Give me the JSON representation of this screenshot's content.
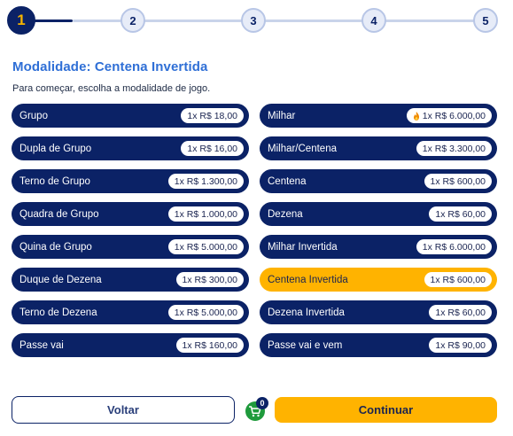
{
  "stepper": {
    "steps": [
      "1",
      "2",
      "3",
      "4",
      "5"
    ],
    "current": 1
  },
  "header": {
    "title": "Modalidade: Centena Invertida",
    "subtitle": "Para começar, escolha a modalidade de jogo."
  },
  "options": {
    "left": [
      {
        "label": "Grupo",
        "price": "1x R$ 18,00"
      },
      {
        "label": "Dupla de Grupo",
        "price": "1x R$ 16,00"
      },
      {
        "label": "Terno de Grupo",
        "price": "1x R$ 1.300,00"
      },
      {
        "label": "Quadra de Grupo",
        "price": "1x R$ 1.000,00"
      },
      {
        "label": "Quina de Grupo",
        "price": "1x R$ 5.000,00"
      },
      {
        "label": "Duque de Dezena",
        "price": "1x R$ 300,00"
      },
      {
        "label": "Terno de Dezena",
        "price": "1x R$ 5.000,00"
      },
      {
        "label": "Passe vai",
        "price": "1x R$ 160,00"
      }
    ],
    "right": [
      {
        "label": "Milhar",
        "price": "1x R$ 6.000,00",
        "icon": "fire-icon"
      },
      {
        "label": "Milhar/Centena",
        "price": "1x R$ 3.300,00"
      },
      {
        "label": "Centena",
        "price": "1x R$ 600,00"
      },
      {
        "label": "Dezena",
        "price": "1x R$ 60,00"
      },
      {
        "label": "Milhar Invertida",
        "price": "1x R$ 6.000,00"
      },
      {
        "label": "Centena Invertida",
        "price": "1x R$ 600,00",
        "selected": true
      },
      {
        "label": "Dezena Invertida",
        "price": "1x R$ 60,00"
      },
      {
        "label": "Passe vai e vem",
        "price": "1x R$ 90,00"
      }
    ]
  },
  "footer": {
    "back_label": "Voltar",
    "continue_label": "Continuar",
    "cart_count": "0"
  },
  "colors": {
    "navy": "#0b2266",
    "accent": "#ffb300",
    "title_blue": "#2f6fd6",
    "cart_green": "#1f9a3c"
  }
}
